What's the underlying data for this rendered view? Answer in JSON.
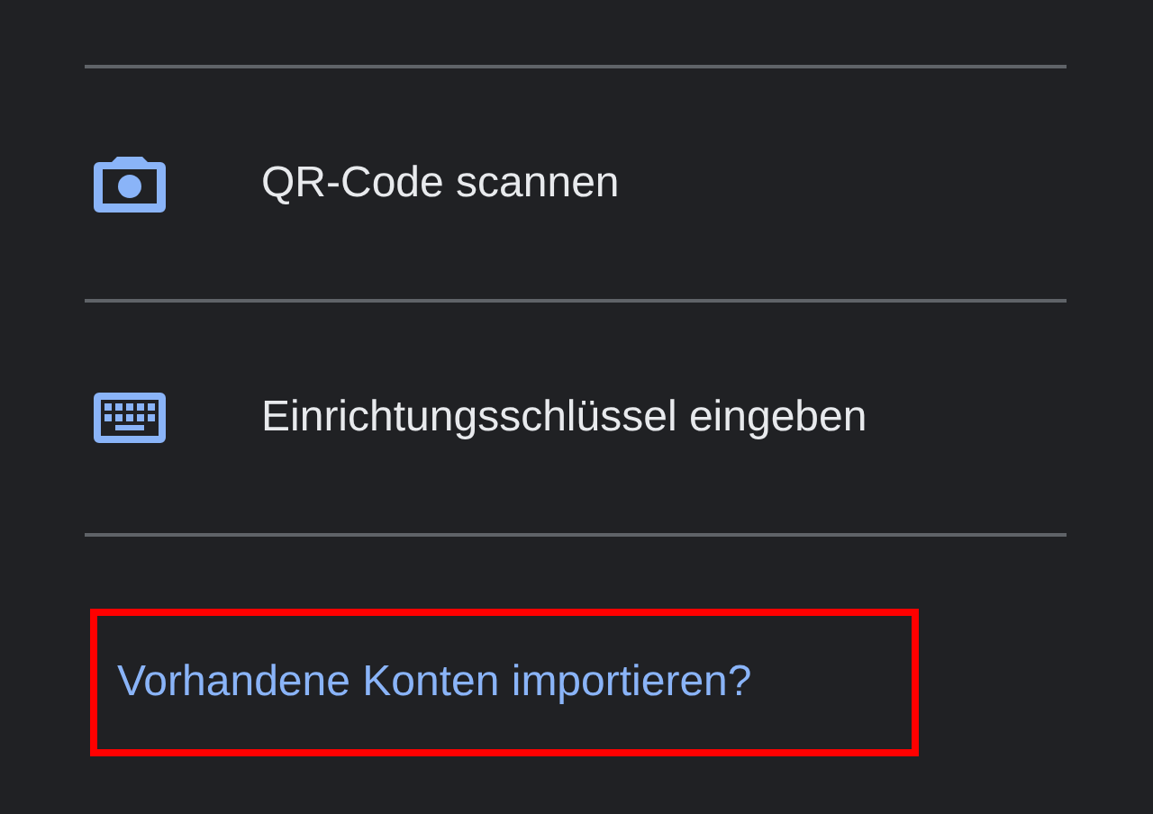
{
  "options": [
    {
      "kind": "camera",
      "label": "QR-Code scannen"
    },
    {
      "kind": "keyboard",
      "label": "Einrichtungsschlüssel eingeben"
    }
  ],
  "import_link": {
    "label": "Vorhandene Konten importieren?",
    "highlighted": true
  }
}
